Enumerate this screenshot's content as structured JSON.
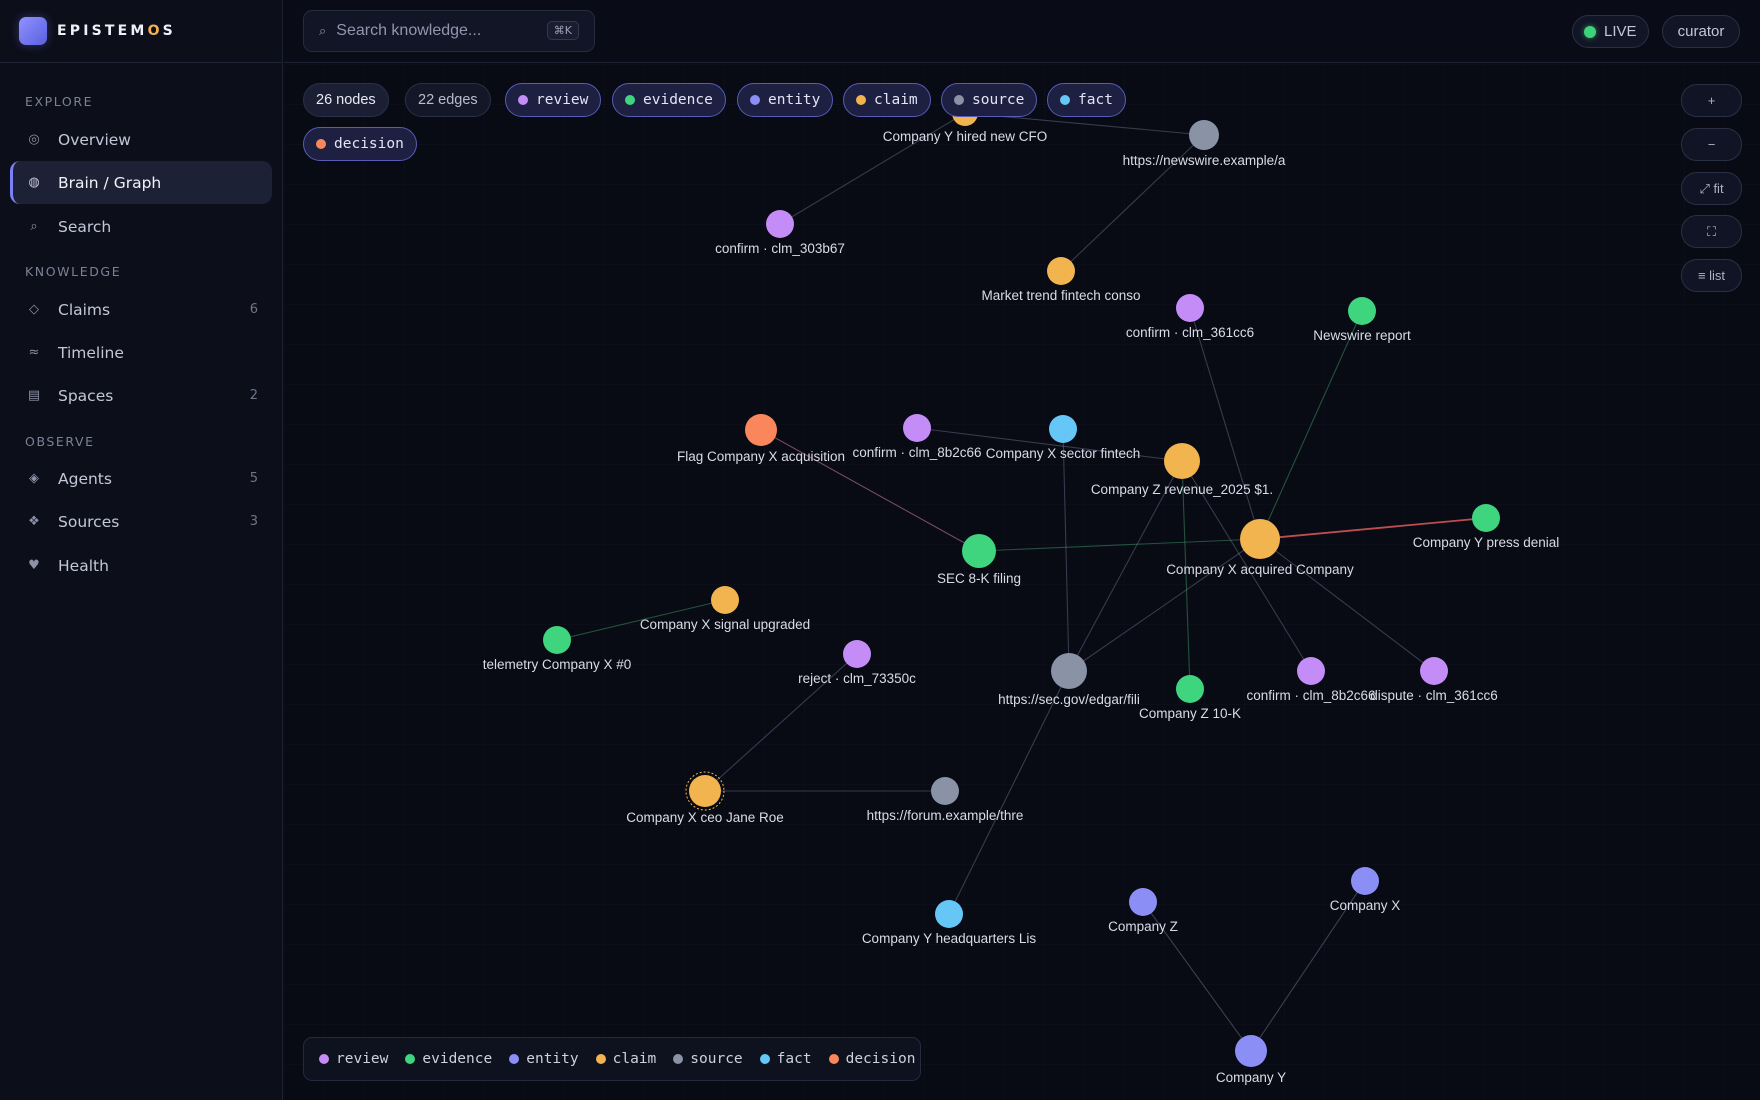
{
  "brand": {
    "name_start": "EPISTEM",
    "name_accent": "O",
    "name_end": "S"
  },
  "sidebar": {
    "sections": [
      {
        "label": "EXPLORE"
      },
      {
        "label": "KNOWLEDGE"
      },
      {
        "label": "OBSERVE"
      }
    ],
    "items": [
      {
        "label": "Overview",
        "icon": "◎",
        "count": ""
      },
      {
        "label": "Brain / Graph",
        "icon": "◍",
        "count": ""
      },
      {
        "label": "Search",
        "icon": "⌕",
        "count": ""
      },
      {
        "label": "Claims",
        "icon": "◇",
        "count": "6"
      },
      {
        "label": "Timeline",
        "icon": "≈",
        "count": ""
      },
      {
        "label": "Spaces",
        "icon": "▤",
        "count": "2"
      },
      {
        "label": "Agents",
        "icon": "◈",
        "count": "5"
      },
      {
        "label": "Sources",
        "icon": "❖",
        "count": "3"
      },
      {
        "label": "Health",
        "icon": "♥",
        "count": ""
      }
    ]
  },
  "topbar": {
    "search_placeholder": "Search knowledge...",
    "search_icon": "⌕",
    "shortcut": "⌘K",
    "live_label": "LIVE",
    "user_label": "curator"
  },
  "graph": {
    "stats": {
      "nodes": "26 nodes",
      "edges": "22 edges"
    },
    "types": [
      {
        "label": "review",
        "color": "#c38cf6"
      },
      {
        "label": "evidence",
        "color": "#3fd57e"
      },
      {
        "label": "entity",
        "color": "#8b8ff5"
      },
      {
        "label": "claim",
        "color": "#f2b44e"
      },
      {
        "label": "source",
        "color": "#8a93a6"
      },
      {
        "label": "fact",
        "color": "#66c7f7"
      },
      {
        "label": "decision",
        "color": "#fa875b"
      }
    ],
    "controls": [
      "+",
      "−",
      "⤢ fit",
      "⛶",
      "≡ list"
    ],
    "nodes": [
      {
        "id": "cfo",
        "label": "Company Y hired new CFO",
        "type": "claim"
      },
      {
        "id": "nw",
        "label": "https://newswire.example/a",
        "type": "source"
      },
      {
        "id": "c303",
        "label": "confirm · clm_303b67",
        "type": "review"
      },
      {
        "id": "mt",
        "label": "Market trend fintech conso",
        "type": "claim"
      },
      {
        "id": "c361",
        "label": "confirm · clm_361cc6",
        "type": "review"
      },
      {
        "id": "nr",
        "label": "Newswire report",
        "type": "evidence"
      },
      {
        "id": "flag",
        "label": "Flag Company X acquisition",
        "type": "decision"
      },
      {
        "id": "c8b",
        "label": "confirm · clm_8b2c66",
        "type": "review"
      },
      {
        "id": "sector",
        "label": "Company X sector fintech",
        "type": "fact"
      },
      {
        "id": "rev",
        "label": "Company Z revenue_2025 $1.",
        "type": "claim"
      },
      {
        "id": "acq",
        "label": "Company X acquired Company",
        "type": "claim"
      },
      {
        "id": "denial",
        "label": "Company Y press denial",
        "type": "evidence"
      },
      {
        "id": "sec",
        "label": "SEC 8-K filing",
        "type": "evidence"
      },
      {
        "id": "sig",
        "label": "Company X signal upgraded",
        "type": "claim"
      },
      {
        "id": "tel",
        "label": "telemetry Company X #0",
        "type": "evidence"
      },
      {
        "id": "rej",
        "label": "reject · clm_73350c",
        "type": "review"
      },
      {
        "id": "edgar",
        "label": "https://sec.gov/edgar/fili",
        "type": "source"
      },
      {
        "id": "z10k",
        "label": "Company Z 10-K",
        "type": "evidence"
      },
      {
        "id": "c8b2",
        "label": "confirm · clm_8b2c66",
        "type": "review"
      },
      {
        "id": "disp",
        "label": "dispute · clm_361cc6",
        "type": "review"
      },
      {
        "id": "ceo",
        "label": "Company X ceo Jane Roe",
        "type": "claim"
      },
      {
        "id": "forum",
        "label": "https://forum.example/thre",
        "type": "source"
      },
      {
        "id": "hq",
        "label": "Company Y headquarters Lis",
        "type": "fact"
      },
      {
        "id": "cz",
        "label": "Company Z",
        "type": "entity"
      },
      {
        "id": "cx",
        "label": "Company X",
        "type": "entity"
      },
      {
        "id": "cy",
        "label": "Company Y",
        "type": "entity"
      }
    ],
    "edges": [
      [
        "cfo",
        "c303"
      ],
      [
        "cfo",
        "nw"
      ],
      [
        "nw",
        "mt"
      ],
      [
        "c8b",
        "rev"
      ],
      [
        "sector",
        "edgar"
      ],
      [
        "flag",
        "sec"
      ],
      [
        "sec",
        "acq"
      ],
      [
        "acq",
        "denial"
      ],
      [
        "acq",
        "nr"
      ],
      [
        "acq",
        "c361"
      ],
      [
        "acq",
        "edgar"
      ],
      [
        "acq",
        "disp"
      ],
      [
        "rev",
        "edgar"
      ],
      [
        "rev",
        "z10k"
      ],
      [
        "rev",
        "c8b2"
      ],
      [
        "edgar",
        "hq"
      ],
      [
        "sig",
        "tel"
      ],
      [
        "rej",
        "ceo"
      ],
      [
        "ceo",
        "forum"
      ],
      [
        "cz",
        "cy"
      ],
      [
        "cx",
        "cy"
      ]
    ]
  }
}
